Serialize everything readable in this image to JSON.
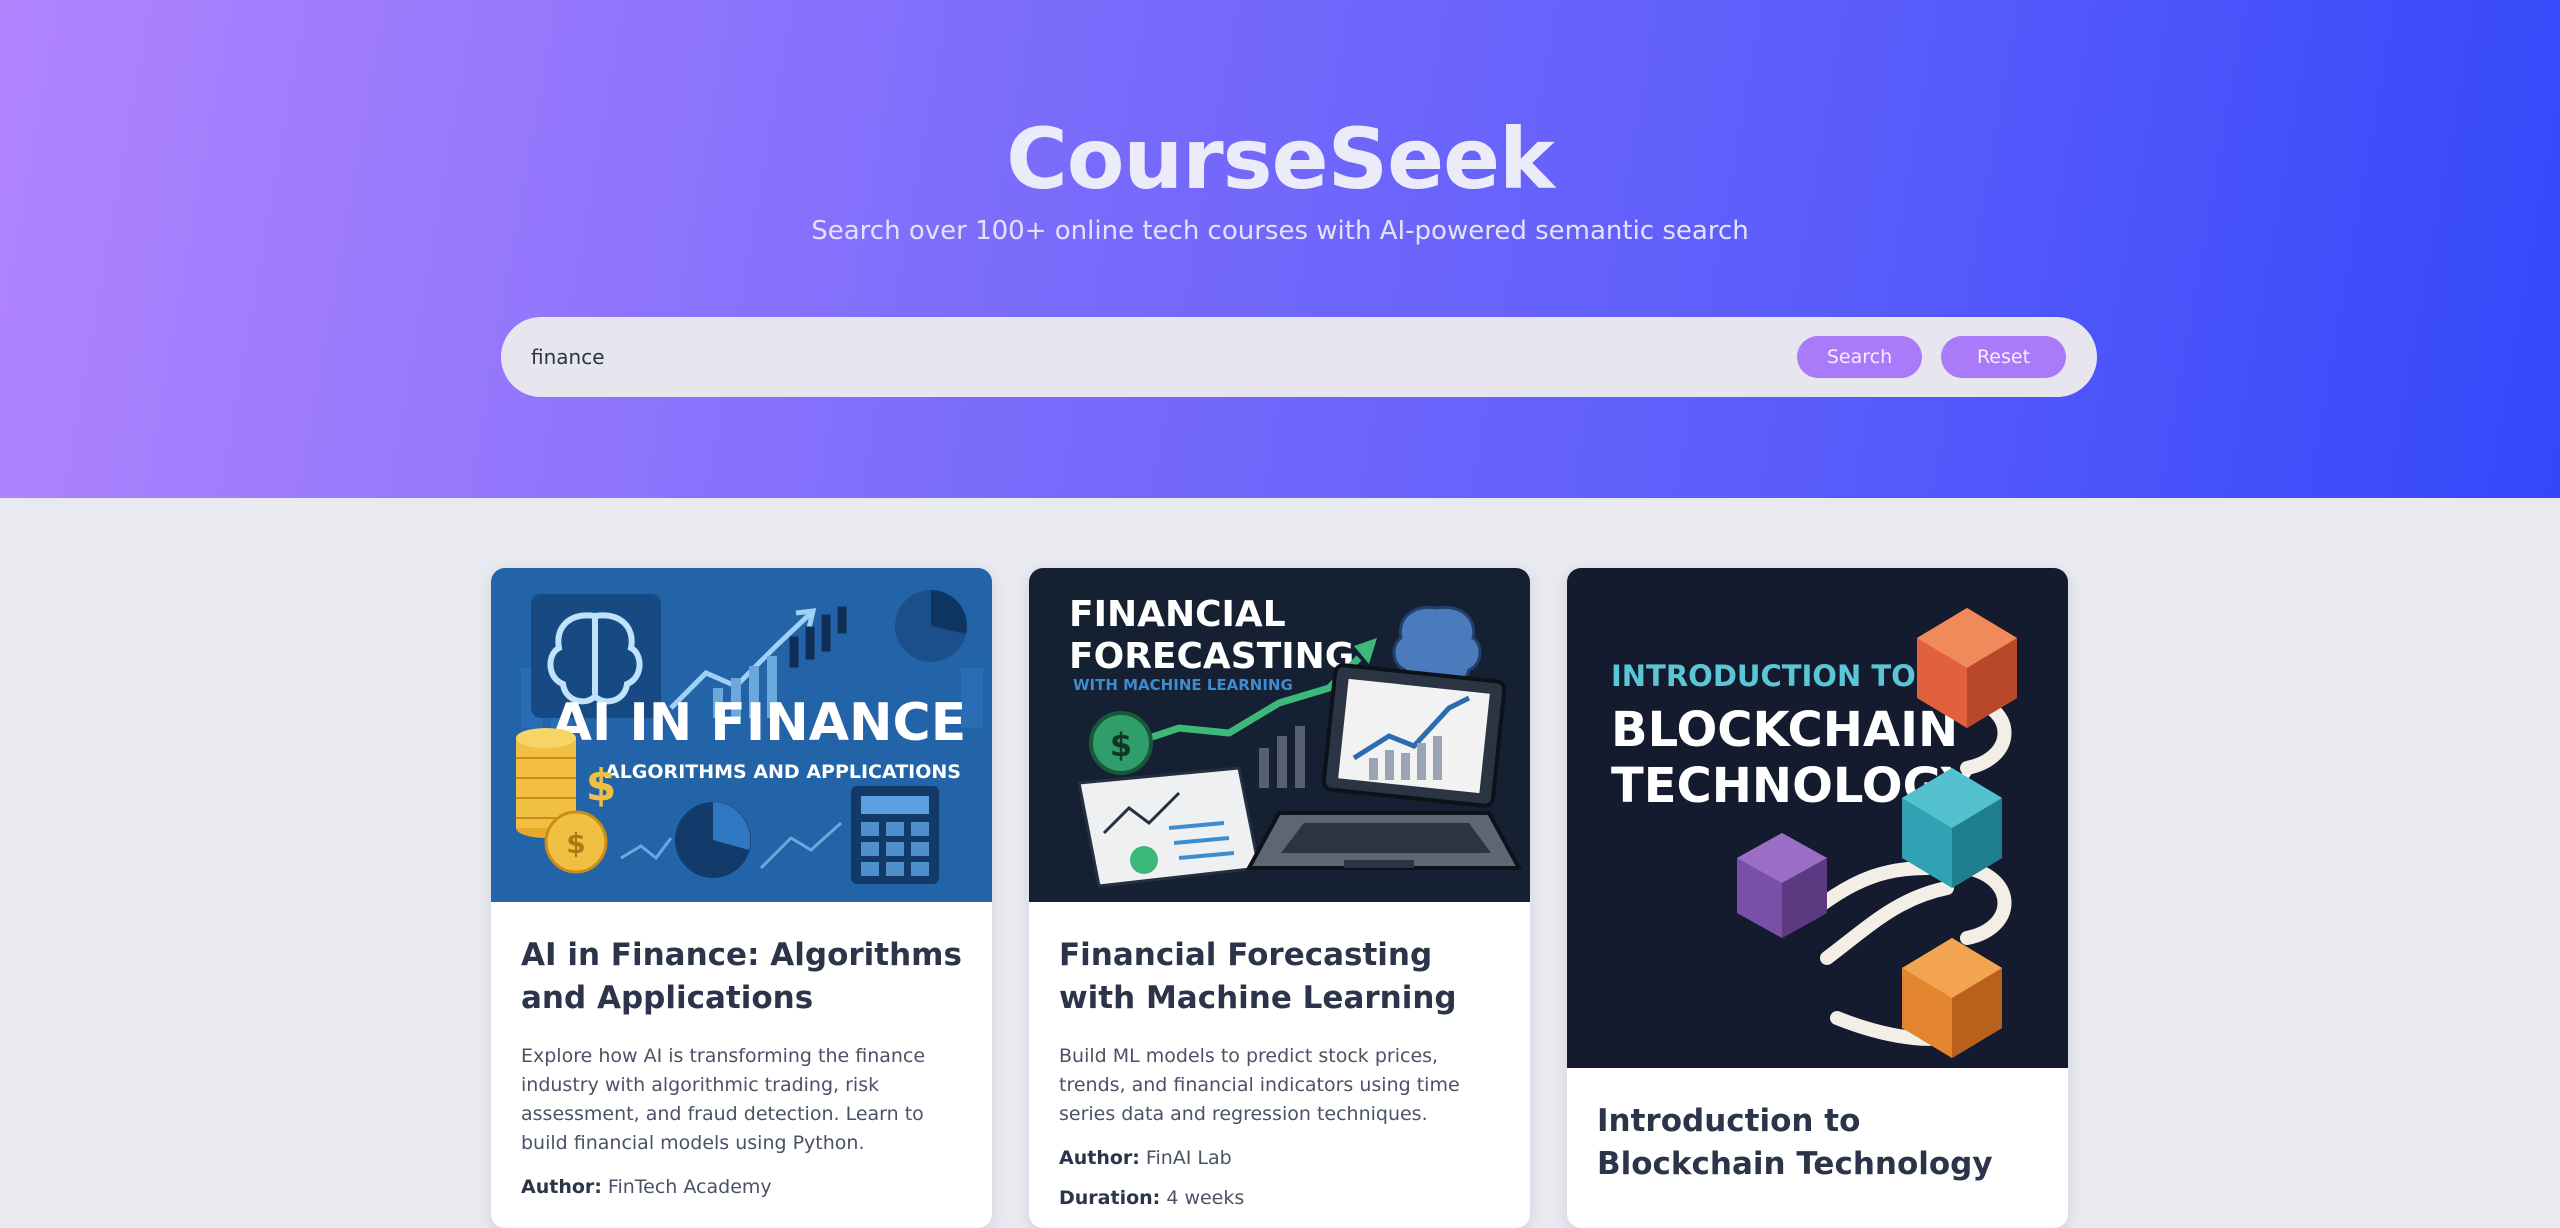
{
  "app": {
    "title": "CourseSeek",
    "tagline": "Search over 100+ online tech courses with AI-powered semantic search"
  },
  "search": {
    "value": "finance",
    "search_label": "Search",
    "reset_label": "Reset"
  },
  "courses": [
    {
      "title": "AI in Finance: Algorithms and Applications",
      "thumb_line1": "AI IN FINANCE",
      "thumb_line2": "ALGORITHMS AND APPLICATIONS",
      "description": "Explore how AI is transforming the finance industry with algorithmic trading, risk assessment, and fraud detection. Learn to build financial models using Python.",
      "author_label": "Author:",
      "author": "FinTech Academy"
    },
    {
      "title": "Financial Forecasting with Machine Learning",
      "thumb_line1": "FINANCIAL",
      "thumb_line2": "FORECASTING",
      "thumb_line3": "WITH MACHINE LEARNING",
      "description": "Build ML models to predict stock prices, trends, and financial indicators using time series data and regression techniques.",
      "author_label": "Author:",
      "author": "FinAI Lab",
      "duration_label": "Duration:",
      "duration": "4 weeks"
    },
    {
      "title": "Introduction to Blockchain Technology",
      "thumb_line1": "INTRODUCTION TO",
      "thumb_line2": "BLOCKCHAIN",
      "thumb_line3": "TECHNOLOGY"
    }
  ]
}
